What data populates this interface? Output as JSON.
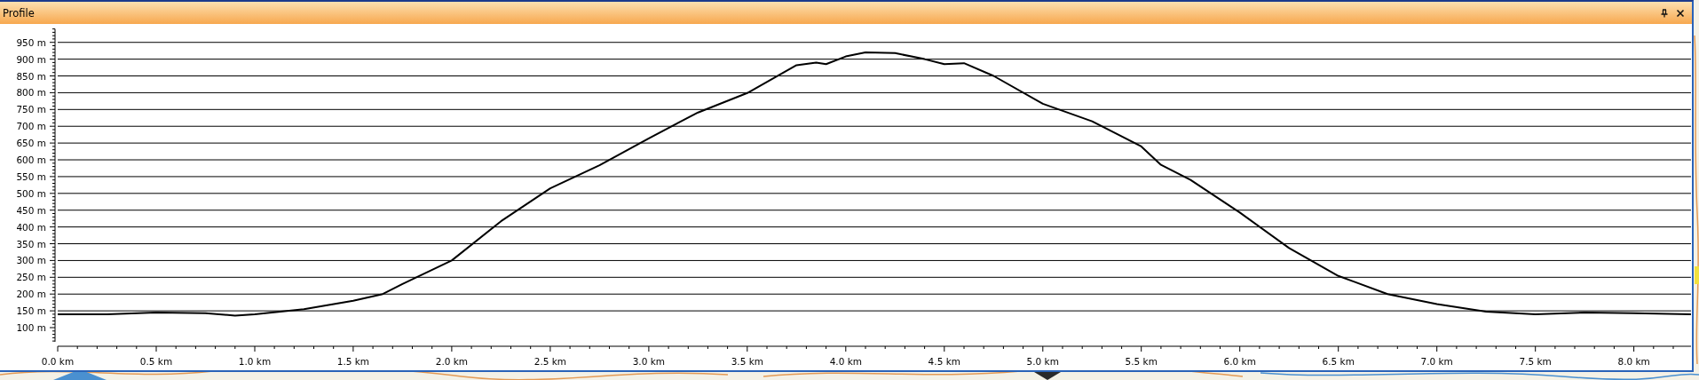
{
  "panel": {
    "title": "Profile"
  },
  "chart_data": {
    "type": "line",
    "grid": true,
    "x": [
      0,
      0.25,
      0.5,
      0.75,
      0.9,
      1.0,
      1.25,
      1.5,
      1.65,
      1.75,
      2.0,
      2.25,
      2.5,
      2.75,
      3.0,
      3.25,
      3.5,
      3.75,
      3.85,
      3.9,
      4.0,
      4.1,
      4.25,
      4.4,
      4.5,
      4.6,
      4.75,
      5.0,
      5.25,
      5.5,
      5.6,
      5.75,
      6.0,
      6.25,
      6.5,
      6.75,
      7.0,
      7.25,
      7.5,
      7.75,
      8.0,
      8.29
    ],
    "series": [
      {
        "color": "#000000",
        "values": [
          140,
          140,
          145,
          143,
          136,
          140,
          155,
          180,
          200,
          230,
          300,
          417,
          515,
          584,
          664,
          741,
          799,
          882,
          890,
          885,
          908,
          920,
          918,
          900,
          885,
          888,
          850,
          767,
          715,
          640,
          585,
          540,
          443,
          337,
          254,
          200,
          170,
          148,
          140,
          145,
          143,
          140
        ]
      }
    ],
    "xlim": [
      0,
      8.29
    ],
    "ylim": [
      58,
      990
    ],
    "xticks": [
      {
        "value": 0,
        "label": "0.0 km"
      },
      {
        "value": 0.5,
        "label": "0.5 km"
      },
      {
        "value": 1,
        "label": "1.0 km"
      },
      {
        "value": 1.5,
        "label": "1.5 km"
      },
      {
        "value": 2,
        "label": "2.0 km"
      },
      {
        "value": 2.5,
        "label": "2.5 km"
      },
      {
        "value": 3,
        "label": "3.0 km"
      },
      {
        "value": 3.5,
        "label": "3.5 km"
      },
      {
        "value": 4,
        "label": "4.0 km"
      },
      {
        "value": 4.5,
        "label": "4.5 km"
      },
      {
        "value": 5,
        "label": "5.0 km"
      },
      {
        "value": 5.5,
        "label": "5.5 km"
      },
      {
        "value": 6,
        "label": "6.0 km"
      },
      {
        "value": 6.5,
        "label": "6.5 km"
      },
      {
        "value": 7,
        "label": "7.0 km"
      },
      {
        "value": 7.5,
        "label": "7.5 km"
      },
      {
        "value": 8,
        "label": "8.0 km"
      }
    ],
    "yticks": [
      {
        "value": 100,
        "label": "100 m"
      },
      {
        "value": 150,
        "label": "150 m"
      },
      {
        "value": 200,
        "label": "200 m"
      },
      {
        "value": 250,
        "label": "250 m"
      },
      {
        "value": 300,
        "label": "300 m"
      },
      {
        "value": 350,
        "label": "350 m"
      },
      {
        "value": 400,
        "label": "400 m"
      },
      {
        "value": 450,
        "label": "450 m"
      },
      {
        "value": 500,
        "label": "500 m"
      },
      {
        "value": 550,
        "label": "550 m"
      },
      {
        "value": 600,
        "label": "600 m"
      },
      {
        "value": 650,
        "label": "650 m"
      },
      {
        "value": 700,
        "label": "700 m"
      },
      {
        "value": 750,
        "label": "750 m"
      },
      {
        "value": 800,
        "label": "800 m"
      },
      {
        "value": 850,
        "label": "850 m"
      },
      {
        "value": 900,
        "label": "900 m"
      },
      {
        "value": 950,
        "label": "950 m"
      }
    ]
  }
}
